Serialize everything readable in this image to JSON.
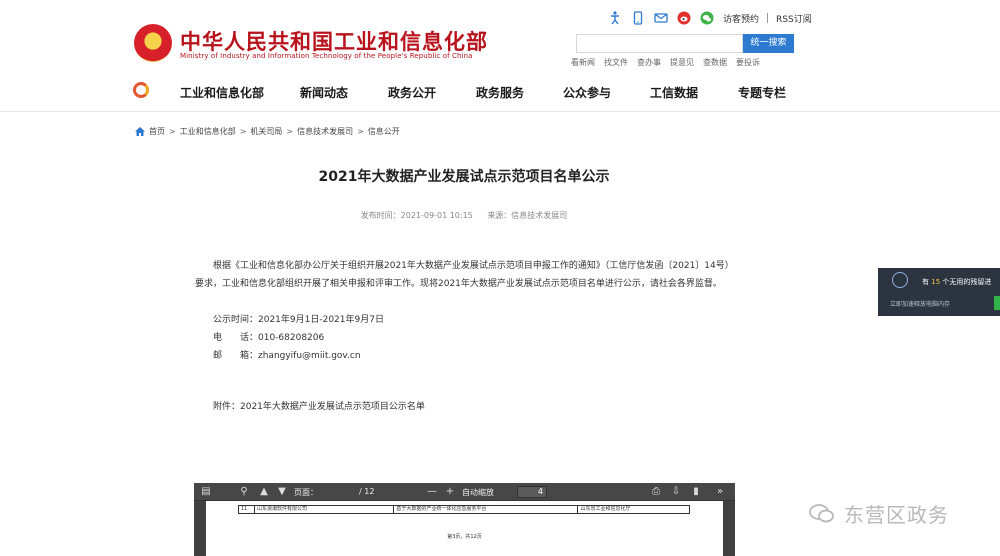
{
  "header": {
    "title": "中华人民共和国工业和信息化部",
    "subtitle": "Ministry of Industry and Information Technology of the People's Republic of China",
    "top_links": {
      "reader": "访客预约",
      "rss": "RSS订阅"
    },
    "search": {
      "placeholder": "",
      "button": "统一搜索"
    },
    "quick_links": [
      "看新闻",
      "找文件",
      "查办事",
      "提意见",
      "查数据",
      "要投诉"
    ]
  },
  "nav": {
    "items": [
      "工业和信息化部",
      "新闻动态",
      "政务公开",
      "政务服务",
      "公众参与",
      "工信数据",
      "专题专栏"
    ]
  },
  "breadcrumb": [
    "首页",
    "工业和信息化部",
    "机关司局",
    "信息技术发展司",
    "信息公开"
  ],
  "article": {
    "title": "2021年大数据产业发展试点示范项目名单公示",
    "publish_time": "发布时间：2021-09-01 10:15",
    "source": "来源：信息技术发展司",
    "paragraph": "根据《工业和信息化部办公厅关于组织开展2021年大数据产业发展试点示范项目申报工作的通知》（工信厅信发函〔2021〕14号）要求，工业和信息化部组织开展了相关申报和评审工作。现将2021年大数据产业发展试点示范项目名单进行公示，请社会各界监督。",
    "notice_time": "公示时间：2021年9月1日-2021年9月7日",
    "phone": "电　　话：010-68208206",
    "email": "邮　　箱：zhangyifu@miit.gov.cn",
    "attachment": "附件：2021年大数据产业发展试点示范项目公示名单"
  },
  "pdf_viewer": {
    "page_label": "页面：",
    "current_page": "4",
    "total_pages": "/ 12",
    "zoom_label": "自动缩放",
    "row": [
      "11",
      "山东浪潮软件有限公司",
      "基于大数据的产业统一体化应急服务平台",
      "山东省工业和信息化厅"
    ],
    "footer": "第3页，共12页"
  },
  "popup": {
    "text_prefix": "有",
    "count": "15",
    "text_suffix": "个无用的残留进",
    "sub": "立即加速释放电脑内存"
  },
  "watermark": {
    "text": "东营区政务"
  },
  "colors": {
    "brand_red": "#b8131c",
    "search_blue": "#2d7ad1",
    "popup_bg": "#2c3440"
  }
}
